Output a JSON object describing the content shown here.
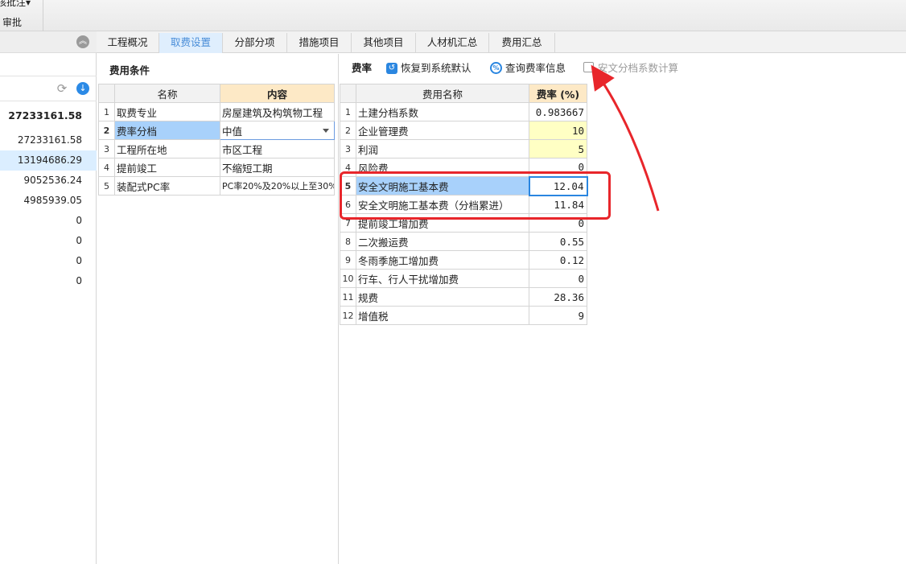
{
  "ribbon": {
    "btn1": "核批注▾",
    "btn2": "审批"
  },
  "sidebar": {
    "values": [
      "27233161.58",
      "27233161.58",
      "13194686.29",
      "9052536.24",
      "4985939.05",
      "0",
      "0",
      "0",
      "0"
    ]
  },
  "tabs": [
    "工程概况",
    "取费设置",
    "分部分项",
    "措施项目",
    "其他项目",
    "人材机汇总",
    "费用汇总"
  ],
  "fee_conditions": {
    "title": "费用条件",
    "col_name": "名称",
    "col_content": "内容",
    "rows": [
      {
        "n": "1",
        "name": "取费专业",
        "content": "房屋建筑及构筑物工程"
      },
      {
        "n": "2",
        "name": "费率分档",
        "content": "中值"
      },
      {
        "n": "3",
        "name": "工程所在地",
        "content": "市区工程"
      },
      {
        "n": "4",
        "name": "提前竣工",
        "content": "不缩短工期"
      },
      {
        "n": "5",
        "name": "装配式PC率",
        "content": "PC率20%及20%以上至30%"
      }
    ]
  },
  "fee_rate": {
    "title": "费率",
    "restore_label": "恢复到系统默认",
    "query_label": "查询费率信息",
    "checkbox_label": "安文分档系数计算",
    "col_name": "费用名称",
    "col_rate": "费率 (%)",
    "rows": [
      {
        "n": "1",
        "name": "土建分档系数",
        "rate": "0.983667"
      },
      {
        "n": "2",
        "name": "企业管理费",
        "rate": "10"
      },
      {
        "n": "3",
        "name": "利润",
        "rate": "5"
      },
      {
        "n": "4",
        "name": "风险费",
        "rate": "0"
      },
      {
        "n": "5",
        "name": "安全文明施工基本费",
        "rate": "12.04"
      },
      {
        "n": "6",
        "name": "安全文明施工基本费（分档累进）",
        "rate": "11.84"
      },
      {
        "n": "7",
        "name": "提前竣工增加费",
        "rate": "0"
      },
      {
        "n": "8",
        "name": "二次搬运费",
        "rate": "0.55"
      },
      {
        "n": "9",
        "name": "冬雨季施工增加费",
        "rate": "0.12"
      },
      {
        "n": "10",
        "name": "行车、行人干扰增加费",
        "rate": "0"
      },
      {
        "n": "11",
        "name": "规费",
        "rate": "28.36"
      },
      {
        "n": "12",
        "name": "增值税",
        "rate": "9"
      }
    ]
  },
  "colors": {
    "accent": "#2a86e0",
    "annotation": "#e8262b",
    "selection": "#a8d1fb",
    "highlight_cell": "#ffffc4"
  }
}
